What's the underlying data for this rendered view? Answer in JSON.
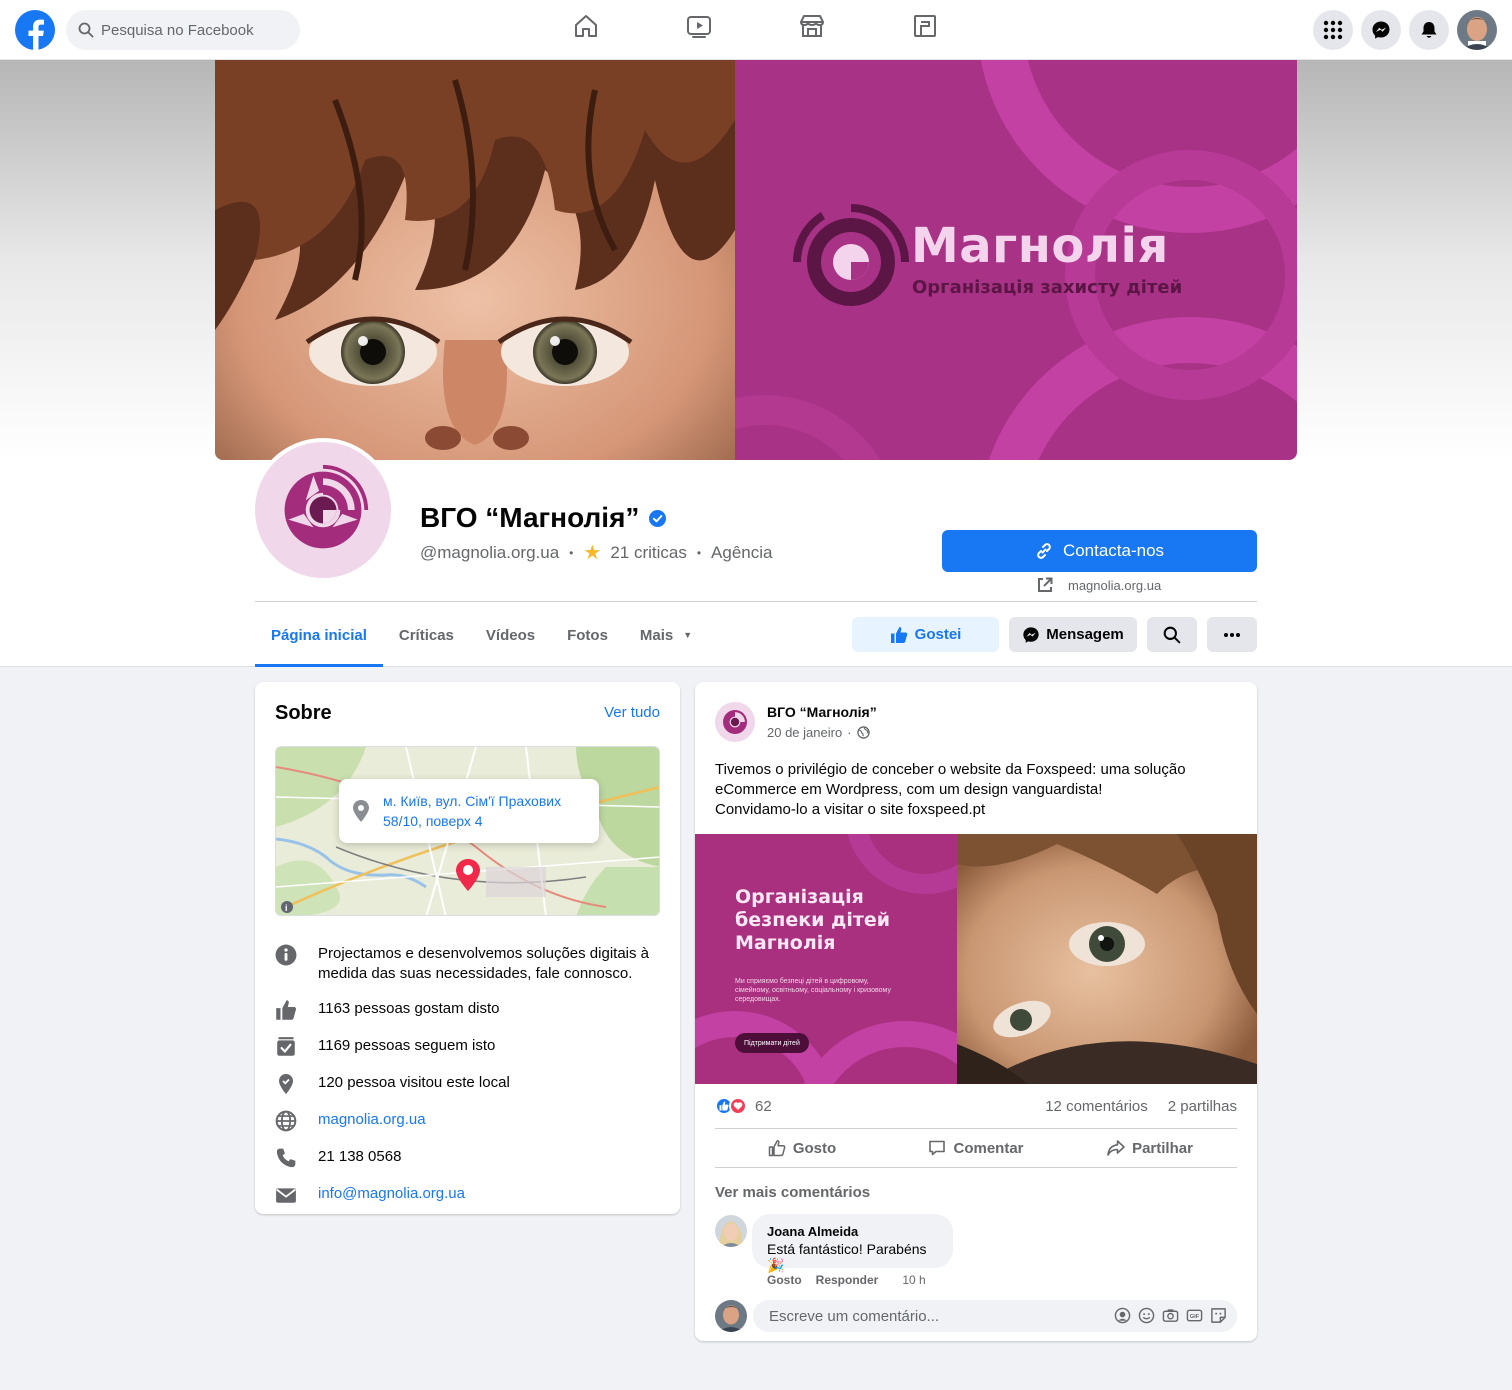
{
  "topbar": {
    "search_placeholder": "Pesquisa no Facebook",
    "nav_icons": [
      "home-icon",
      "watch-icon",
      "marketplace-icon",
      "gaming-icon"
    ],
    "right_icons": [
      "menu-grid-icon",
      "messenger-icon",
      "notifications-icon"
    ]
  },
  "cover": {
    "brand_title": "Магнолія",
    "brand_subtitle": "Організація захисту дітей"
  },
  "page": {
    "name": "ВГО “Магнолія”",
    "handle": "@magnolia.org.ua",
    "reviews": "21 criticas",
    "category": "Agência",
    "contact_button": "Contacta-nos",
    "website": "magnolia.org.ua"
  },
  "tabs": [
    {
      "label": "Página inicial",
      "active": true
    },
    {
      "label": "Críticas",
      "active": false
    },
    {
      "label": "Vídeos",
      "active": false
    },
    {
      "label": "Fotos",
      "active": false
    },
    {
      "label": "Mais",
      "active": false
    }
  ],
  "actions": {
    "like": "Gostei",
    "message": "Mensagem"
  },
  "about": {
    "title": "Sobre",
    "see_all": "Ver tudo",
    "address": "м. Київ, вул. Сім'ї Прахових 58/10, поверх 4",
    "description": "Projectamos e desenvolvemos soluções digitais à medida das suas necessidades, fale connosco.",
    "likes": "1163 pessoas gostam disto",
    "follows": "1169 pessoas seguem isto",
    "visits": "120 pessoa visitou este local",
    "website": "magnolia.org.ua",
    "phone": "21 138 0568",
    "email": "info@magnolia.org.ua"
  },
  "post": {
    "author": "ВГО “Магнолія”",
    "date": "20 de janeiro",
    "dot": "·",
    "text_lines": [
      "Tivemos o privilégio de conceber o website da Foxspeed: uma solução",
      "eCommerce em Wordpress, com um design vanguardista!",
      "Convidamo-lo a visitar o site foxspeed.pt"
    ],
    "image": {
      "heading": "Організація безпеки дітей Магнолія",
      "paragraph": "Ми сприяємо безпеці дітей в цифровому, сімейному, освітньому, соціальному і кризовому середовищах.",
      "cta": "Підтримати дітей"
    },
    "reactions_count": "62",
    "comments_count": "12 comentários",
    "shares_count": "2 partilhas",
    "buttons": {
      "like": "Gosto",
      "comment": "Comentar",
      "share": "Partilhar"
    },
    "more_comments": "Ver mais comentários",
    "comment": {
      "name": "Joana Almeida",
      "text": "Está fantástico! Parabéns 🎉",
      "like": "Gosto",
      "reply": "Responder",
      "time": "10 h"
    },
    "write_placeholder": "Escreve um comentário..."
  }
}
